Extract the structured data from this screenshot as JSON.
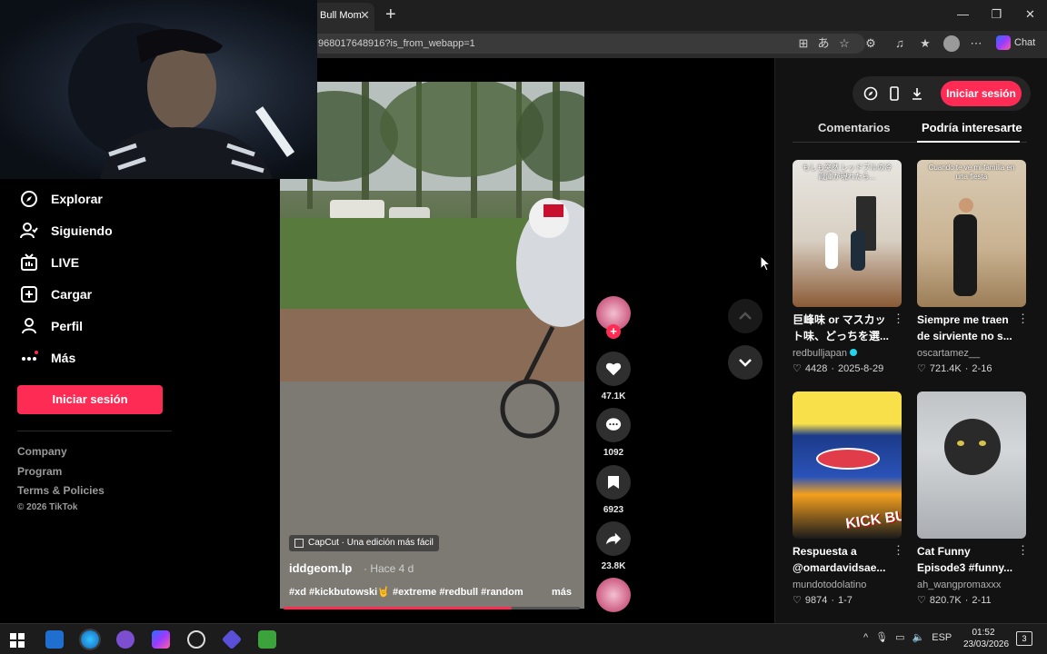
{
  "browser": {
    "tab_title": "Bull Mom",
    "tab_close": "✕",
    "new_tab": "+",
    "window_controls": [
      "—",
      "❐",
      "✕"
    ],
    "url": "968017648916?is_from_webapp=1",
    "chat_label": "Chat"
  },
  "sidebar": {
    "items": [
      {
        "label": "Explorar",
        "icon": "compass-icon"
      },
      {
        "label": "Siguiendo",
        "icon": "user-follow-icon"
      },
      {
        "label": "LIVE",
        "icon": "live-tv-icon"
      },
      {
        "label": "Cargar",
        "icon": "upload-plus-icon"
      },
      {
        "label": "Perfil",
        "icon": "profile-icon"
      },
      {
        "label": "Más",
        "icon": "more-dots-icon"
      }
    ],
    "login_label": "Iniciar sesión",
    "footer": [
      "Company",
      "Program",
      "Terms & Policies",
      "© 2026 TikTok"
    ]
  },
  "video": {
    "capcut_badge": "CapCut · Una edición más fácil",
    "author": "iddgeom.lp",
    "time_ago": "· Hace 4 d",
    "hashtags": "#xd #kickbutowski🤘 #extreme #redbull #random",
    "more_label": "más",
    "progress": 0.77,
    "likes": "47.1K",
    "comments": "1092",
    "saves": "6923",
    "shares": "23.8K"
  },
  "right_panel": {
    "login_label": "Iniciar sesión",
    "tabs": [
      "Comentarios",
      "Podría interesarte"
    ],
    "active_tab": "Podría interesarte",
    "recommendations": [
      {
        "title": "巨峰味 or マスカット味、どっちを選...",
        "user": "redbulljapan",
        "verified": true,
        "likes": "4428",
        "date": "2025-8-29",
        "thumb_caption": "もしも突然 レッドブルの冷蔵庫が現れたら..."
      },
      {
        "title": "Siempre me traen de sirviente no s...",
        "user": "oscartamez__",
        "verified": false,
        "likes": "721.4K",
        "date": "2-16",
        "thumb_caption": "Cuando te ve mi familia en una fiesta"
      },
      {
        "title": "Respuesta a @omardavidsae...",
        "user": "mundotodolatino",
        "verified": false,
        "likes": "9874",
        "date": "1-7",
        "thumb_caption": "KICK BUTTOWSKI"
      },
      {
        "title": "Cat Funny Episode3 #funny...",
        "user": "ah_wangpromaxxx",
        "verified": false,
        "likes": "820.7K",
        "date": "2-11",
        "thumb_caption": ""
      }
    ]
  },
  "taskbar": {
    "language": "ESP",
    "time": "01:52",
    "date": "23/03/2026",
    "notifications": "3"
  },
  "colors": {
    "accent": "#fe2c55",
    "background": "#000000",
    "panel": "#121212"
  }
}
